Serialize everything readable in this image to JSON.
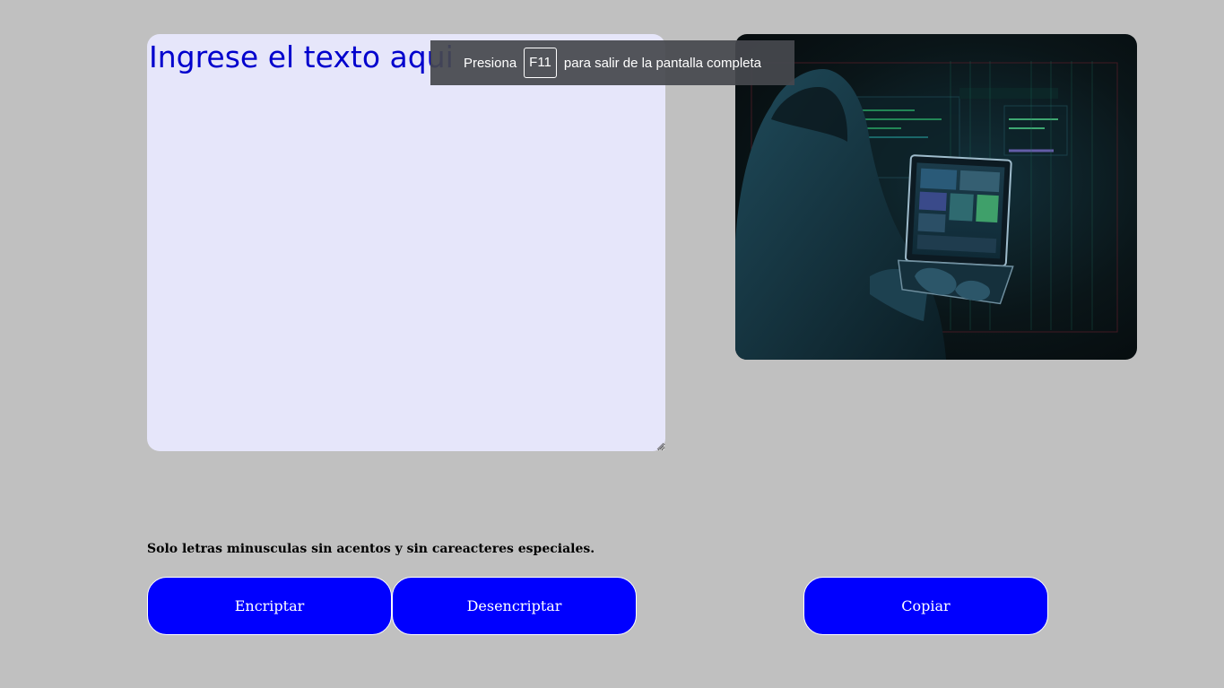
{
  "input": {
    "placeholder": "Ingrese el texto aqui"
  },
  "image": {
    "subject": "hooded hacker at laptop"
  },
  "fullscreen_notice": {
    "prefix": "Presiona",
    "key": "F11",
    "suffix": "para salir de la pantalla completa"
  },
  "notice": "Solo letras minusculas sin acentos y sin careacteres especiales.",
  "buttons": {
    "encrypt": "Encriptar",
    "decrypt": "Desencriptar",
    "copy": "Copiar"
  },
  "colors": {
    "background": "#c0c0c0",
    "textarea": "#e6e6fa",
    "button": "#0000ff",
    "input_text": "#0000cd"
  },
  "icons": {
    "resize": "resize-grip-icon"
  }
}
